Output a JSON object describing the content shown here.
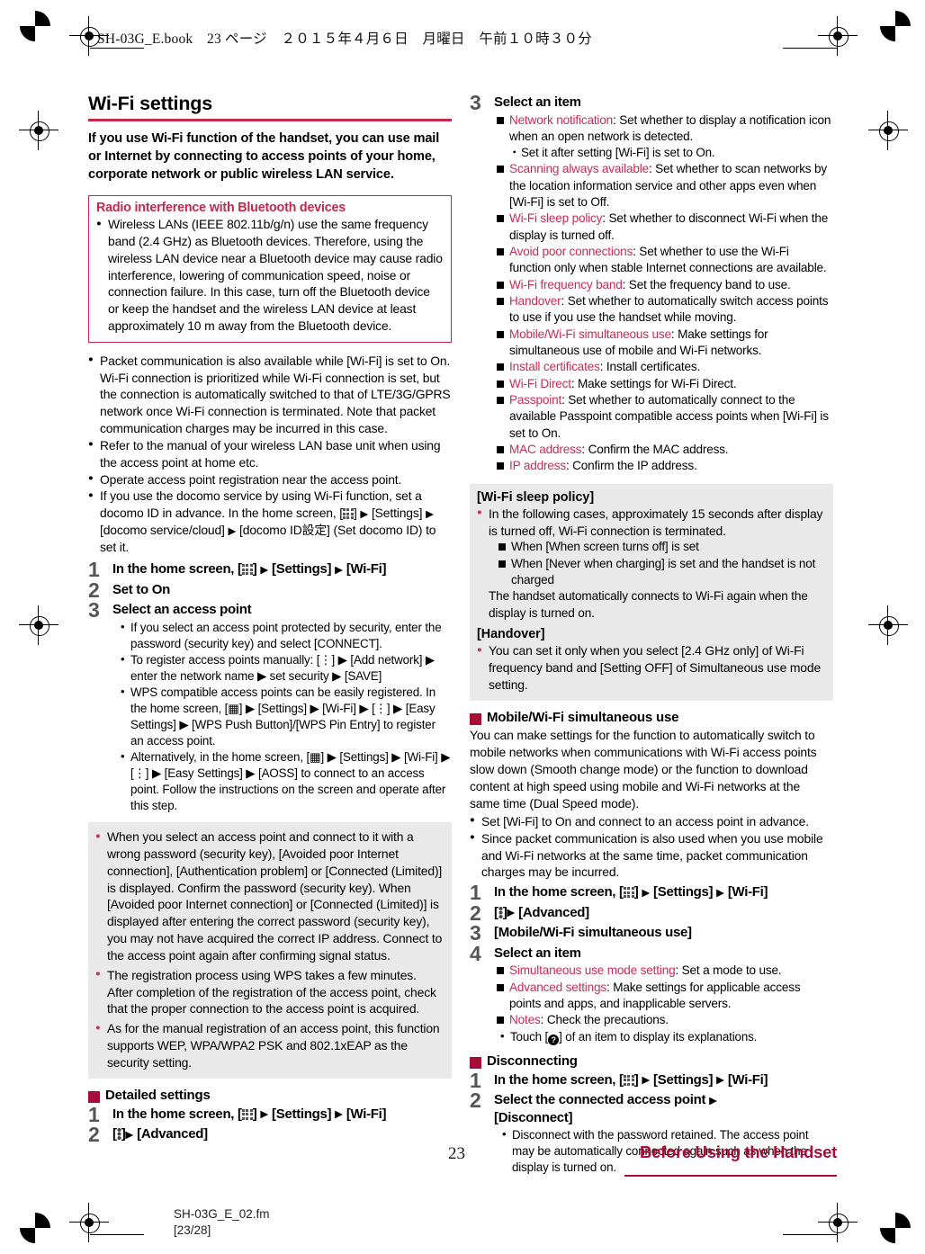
{
  "header": {
    "print_info": "SH-03G_E.book　23 ページ　２０１５年４月６日　月曜日　午前１０時３０分"
  },
  "footer": {
    "page_number": "23",
    "section_label": "Before Using the Handset",
    "file_name": "SH-03G_E_02.fm",
    "file_page": "[23/28]"
  },
  "colors": {
    "accent": "#a90c38",
    "title_rule": "#c2294e",
    "term": "#cc2a55",
    "note_bg": "#e9e9e9",
    "step_number": "#555555"
  },
  "icons": {
    "apps": "apps-grid-icon",
    "menu": "overflow-menu-icon",
    "arrow": "▶",
    "help": "help-circle-icon"
  },
  "left_column": {
    "title": "Wi-Fi settings",
    "lead": "If you use Wi-Fi function of the handset, you can use mail or Internet by connecting to access points of your home, corporate network or public wireless LAN service.",
    "bordered_box": {
      "heading": "Radio interference with Bluetooth devices",
      "bullets": [
        "Wireless LANs (IEEE 802.11b/g/n) use the same frequency band (2.4 GHz) as Bluetooth devices. Therefore, using the wireless LAN device near a Bluetooth device may cause radio interference, lowering of communication speed, noise or connection failure. In this case, turn off the Bluetooth device or keep the handset and the wireless LAN device at least approximately 10 m away from the Bluetooth device."
      ]
    },
    "notes": [
      "Packet communication is also available while [Wi-Fi] is set to On. Wi-Fi connection is prioritized while Wi-Fi connection is set, but the connection is automatically switched to that of LTE/3G/GPRS network once Wi-Fi connection is terminated. Note that packet communication charges may be incurred in this case.",
      "Refer to the manual of your wireless LAN base unit when using the access point at home etc.",
      "Operate access point registration near the access point."
    ],
    "note_docomo_id": {
      "part1": "If you use the docomo service by using Wi-Fi function, set a docomo ID in advance. In the home screen, [",
      "part2": "] ",
      "part3": " [Settings] ",
      "part4": " [docomo service/cloud] ",
      "part5": " [docomo ID設定] (Set docomo ID) to set it."
    },
    "steps": [
      {
        "num": "1",
        "segments": [
          "In the home screen, [",
          "] ",
          " [Settings] ",
          " [Wi-Fi]"
        ]
      },
      {
        "num": "2",
        "text": "Set to On"
      },
      {
        "num": "3",
        "text": "Select an access point"
      }
    ],
    "step3_subitems": [
      "If you select an access point protected by security, enter the password (security key) and select [CONNECT].",
      "To register access points manually: [⋮] ▶ [Add network] ▶ enter the network name ▶ set security ▶ [SAVE]",
      "WPS compatible access points can be easily registered. In the home screen, [▦] ▶ [Settings] ▶ [Wi-Fi] ▶ [⋮] ▶ [Easy Settings] ▶ [WPS Push Button]/[WPS Pin Entry] to register an access point.",
      "Alternatively, in the home screen, [▦] ▶ [Settings] ▶ [Wi-Fi] ▶ [⋮] ▶ [Easy Settings] ▶ [AOSS] to connect to an access point. Follow the instructions on the screen and operate after this step."
    ],
    "gray_notes": [
      "When you select an access point and connect to it with a wrong password (security key), [Avoided poor Internet connection], [Authentication problem] or [Connected (Limited)] is displayed. Confirm the password (security key). When [Avoided poor Internet connection] or [Connected (Limited)] is displayed after entering the correct password (security key), you may not have acquired the correct IP address. Connect to the access point again after confirming signal status.",
      "The registration process using WPS takes a few minutes. After completion of the registration of the access point, check that the proper connection to the access point is acquired.",
      "As for the manual registration of an access point, this function supports WEP, WPA/WPA2 PSK and 802.1xEAP as the security setting."
    ],
    "detailed_settings": {
      "heading": "Detailed settings",
      "step1_num": "1",
      "step2_num": "2",
      "step2_label": " [Advanced]"
    }
  },
  "right_column": {
    "step3": {
      "num": "3",
      "text": "Select an item"
    },
    "settings_items": [
      {
        "term": "Network notification",
        "desc": ": Set whether to display a notification icon when an open network is detected."
      },
      {
        "term": "Scanning always available",
        "desc": ": Set whether to scan networks by the location information service and other apps even when [Wi-Fi] is set to Off."
      },
      {
        "term": "Wi-Fi sleep policy",
        "desc": ": Set whether to disconnect Wi-Fi when the display is turned off."
      },
      {
        "term": "Avoid poor connections",
        "desc": ": Set whether to use the Wi-Fi function only when stable Internet connections are available."
      },
      {
        "term": "Wi-Fi frequency band",
        "desc": ": Set the frequency band to use."
      },
      {
        "term": "Handover",
        "desc": ": Set whether to automatically switch access points to use if you use the handset while moving."
      },
      {
        "term": "Mobile/Wi-Fi simultaneous use",
        "desc": ": Make settings for simultaneous use of mobile and Wi-Fi networks."
      },
      {
        "term": "Install certificates",
        "desc": ": Install certificates."
      },
      {
        "term": "Wi-Fi Direct",
        "desc": ": Make settings for Wi-Fi Direct."
      },
      {
        "term": "Passpoint",
        "desc": ": Set whether to automatically connect to the available Passpoint compatible access points when [Wi-Fi] is set to On."
      },
      {
        "term": "MAC address",
        "desc": ": Confirm the MAC address."
      },
      {
        "term": "IP address",
        "desc": ": Confirm the IP address."
      }
    ],
    "network_notification_sub": "Set it after setting [Wi-Fi] is set to On.",
    "gray_box": {
      "sleep_policy_heading": "[Wi-Fi sleep policy]",
      "sleep_policy_bullet": "In the following cases, approximately 15 seconds after display is turned off, Wi-Fi connection is terminated.",
      "sleep_policy_cases": [
        "When [When screen turns off] is set",
        "When [Never when charging] is set and the handset is not charged"
      ],
      "sleep_policy_tail": "The handset automatically connects to Wi-Fi again when the display is turned on.",
      "handover_heading": "[Handover]",
      "handover_bullet": "You can set it only when you select [2.4 GHz only] of Wi-Fi frequency band and [Setting OFF] of Simultaneous use mode setting."
    },
    "simultaneous": {
      "heading": "Mobile/Wi-Fi simultaneous use",
      "para": "You can make settings for the function to automatically switch to mobile networks when communications with Wi-Fi access points slow down (Smooth change mode) or the function to download content at high speed using mobile and Wi-Fi networks at the same time (Dual Speed mode).",
      "notes": [
        "Set [Wi-Fi] to On and connect to an access point in advance.",
        "Since packet communication is also used when you use mobile and Wi-Fi networks at the same time, packet communication charges may be incurred."
      ],
      "steps": [
        {
          "num": "1"
        },
        {
          "num": "2",
          "label": " [Advanced]"
        },
        {
          "num": "3",
          "text": "[Mobile/Wi-Fi simultaneous use]"
        },
        {
          "num": "4",
          "text": "Select an item"
        }
      ],
      "items": [
        {
          "term": "Simultaneous use mode setting",
          "desc": ": Set a mode to use."
        },
        {
          "term": "Advanced settings",
          "desc": ": Make settings for applicable access points and apps, and inapplicable servers."
        },
        {
          "term": "Notes",
          "desc": ": Check the precautions."
        }
      ],
      "touch_note_a": "Touch [",
      "touch_note_b": "] of an item to display its explanations."
    },
    "disconnecting": {
      "heading": "Disconnecting",
      "step1_num": "1",
      "step2_num": "2",
      "step2_text_a": "Select the connected access point ",
      "step2_text_b": "[Disconnect]",
      "note": "Disconnect with the password retained. The access point may be automatically connected again such as when the display is turned on."
    }
  },
  "common": {
    "home_screen_prefix": "In the home screen, [",
    "bracket_close": "] ",
    "settings_label": " [Settings] ",
    "wifi_label": " [Wi-Fi]"
  }
}
